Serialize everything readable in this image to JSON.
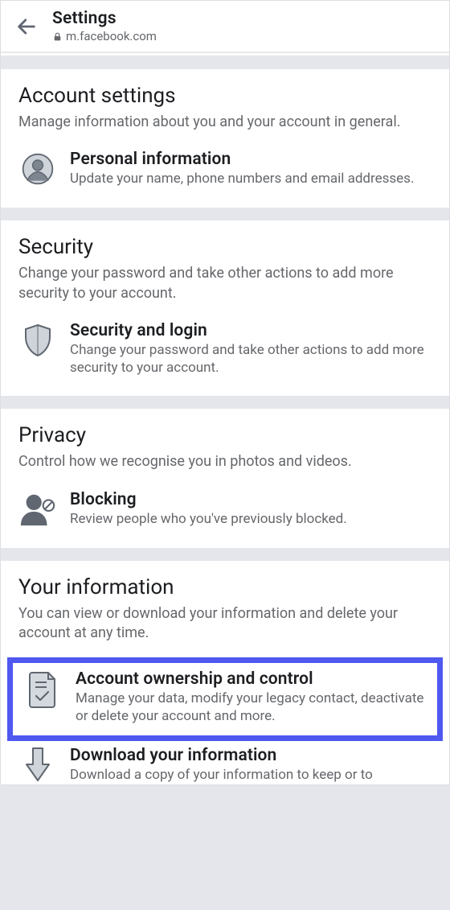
{
  "header": {
    "title": "Settings",
    "url": "m.facebook.com"
  },
  "sections": {
    "account": {
      "title": "Account settings",
      "desc": "Manage information about you and your account in general.",
      "item": {
        "title": "Personal information",
        "desc": "Update your name, phone numbers and email addresses."
      }
    },
    "security": {
      "title": "Security",
      "desc": "Change your password and take other actions to add more security to your account.",
      "item": {
        "title": "Security and login",
        "desc": "Change your password and take other actions to add more security to your account."
      }
    },
    "privacy": {
      "title": "Privacy",
      "desc": "Control how we recognise you in photos and videos.",
      "item": {
        "title": "Blocking",
        "desc": "Review people who you've previously blocked."
      }
    },
    "info": {
      "title": "Your information",
      "desc": "You can view or download your information and delete your account at any time.",
      "item1": {
        "title": "Account ownership and control",
        "desc": "Manage your data, modify your legacy contact, deactivate or delete your account and more."
      },
      "item2": {
        "title": "Download your information",
        "desc": "Download a copy of your information to keep or to"
      }
    }
  }
}
